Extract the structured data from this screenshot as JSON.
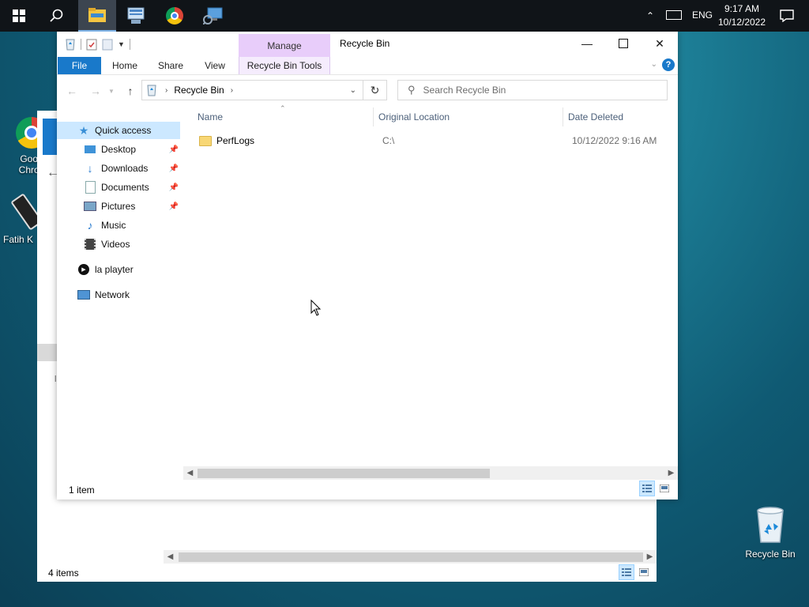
{
  "taskbar": {
    "clock_time": "9:17 AM",
    "clock_date": "10/12/2022",
    "language": "ENG",
    "icons": [
      "windows-start-icon",
      "search-icon",
      "file-explorer-icon",
      "remote-desktop-icon",
      "chrome-icon",
      "network-monitor-icon"
    ]
  },
  "desktop": {
    "icon_chrome_label_1": "Goog",
    "icon_chrome_label_2": "Chron",
    "icon_fatih_label": "Fatih K",
    "icon_recycle_label": "Recycle Bin"
  },
  "back_window": {
    "status_items": "4 items",
    "side_glyph": "l"
  },
  "explorer": {
    "title": "Recycle Bin",
    "manage_tab": "Manage",
    "ribbon_tabs": {
      "file": "File",
      "home": "Home",
      "share": "Share",
      "view": "View",
      "tools": "Recycle Bin Tools"
    },
    "address": {
      "segment": "Recycle Bin"
    },
    "search": {
      "placeholder": "Search Recycle Bin"
    },
    "nav": {
      "quick_access": "Quick access",
      "desktop": "Desktop",
      "downloads": "Downloads",
      "documents": "Documents",
      "pictures": "Pictures",
      "music": "Music",
      "videos": "Videos",
      "la_player": "la playter",
      "network": "Network"
    },
    "columns": {
      "name": "Name",
      "original_location": "Original Location",
      "date_deleted": "Date Deleted"
    },
    "rows": [
      {
        "name": "PerfLogs",
        "original_location": "C:\\",
        "date_deleted": "10/12/2022 9:16 AM"
      }
    ],
    "status": "1 item"
  }
}
